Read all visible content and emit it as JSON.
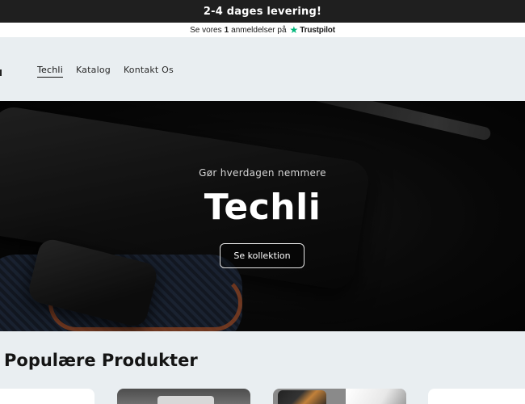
{
  "announcement": {
    "text": "2-4 dages levering!"
  },
  "trustbar": {
    "prefix": "Se vores",
    "count": "1",
    "suffix": "anmeldelser på",
    "star_icon": "★",
    "brand": "Trustpilot",
    "star_color": "#00b67a"
  },
  "nav": {
    "items": [
      {
        "label": "Techli"
      },
      {
        "label": "Katalog"
      },
      {
        "label": "Kontakt Os"
      }
    ]
  },
  "hero": {
    "subtitle": "Gør hverdagen nemmere",
    "title": "Techli",
    "cta_label": "Se kollektion"
  },
  "section": {
    "title": "Populære Produkter"
  }
}
